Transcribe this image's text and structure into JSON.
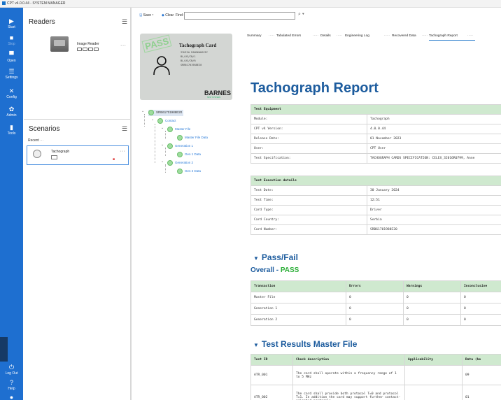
{
  "window": {
    "title": "CPT v4.0.0.44 - SYSTEM MANAGER"
  },
  "nav": {
    "items": [
      {
        "label": "Start",
        "icon": "play-icon"
      },
      {
        "label": "Stop",
        "icon": "stop-icon"
      },
      {
        "label": "Open",
        "icon": "folder-icon"
      },
      {
        "label": "Settings",
        "icon": "settings-list-icon"
      },
      {
        "label": "Config",
        "icon": "tools-icon"
      },
      {
        "label": "Admin",
        "icon": "admin-gear-icon"
      },
      {
        "label": "Tools",
        "icon": "device-icon"
      }
    ],
    "bottom": [
      {
        "label": "Log Out",
        "icon": "power-icon"
      },
      {
        "label": "Help",
        "icon": "help-icon"
      }
    ]
  },
  "readers": {
    "title": "Readers",
    "item": {
      "name": "Image Reader",
      "more": "···"
    }
  },
  "scenarios": {
    "title": "Scenarios",
    "recent_label": "Recent",
    "recent_more": "···",
    "item": {
      "name": "Tachograph",
      "more": "···"
    }
  },
  "toolbar": {
    "save": "Save",
    "clear": "Clear",
    "find_label": "Find:",
    "find_value": ""
  },
  "card": {
    "stamp": "PASS",
    "title": "Tachograph Card",
    "lines": [
      "IIKISA PANSKAKOVIC",
      "BL/US/CN/1",
      "BL/US/CN/R",
      "SRB61701988E20"
    ],
    "brand": "BARNES",
    "brand_sub": "TEST SYSTEMS"
  },
  "tree": {
    "root": "SRB61701988E20",
    "nodes": [
      {
        "label": "Contact"
      },
      {
        "label": "Master File"
      },
      {
        "label": "Master File Data"
      },
      {
        "label": "Generation 1"
      },
      {
        "label": "Gen 1 Data"
      },
      {
        "label": "Generation 2"
      },
      {
        "label": "Gen 2 Data"
      }
    ]
  },
  "tabs": [
    "Summary",
    "Tabulated Errors",
    "Details",
    "Engineering Log",
    "Recovered Data",
    "Tachograph Report"
  ],
  "tab_sep": "·····",
  "report": {
    "title": "Tachograph Report",
    "equipment": {
      "header": "Test Equipment",
      "rows": [
        [
          "Module:",
          "Tachograph"
        ],
        [
          "CPT v4 Version:",
          "4.0.0.44"
        ],
        [
          "Release Date:",
          "01 November 2023"
        ],
        [
          "User:",
          "CPT User"
        ],
        [
          "Test Specification:",
          "TACHOGRAPH CARDS SPECIFICATION: CELEX_32016R0799, Anne"
        ]
      ]
    },
    "execution": {
      "header": "Test Execution details",
      "rows": [
        [
          "Test Date:",
          "30 January 2024"
        ],
        [
          "Test Time:",
          "12:51"
        ],
        [
          "Card Type:",
          "Driver"
        ],
        [
          "Card Country:",
          "Serbia"
        ],
        [
          "Card Number:",
          "SRB61701988E20"
        ]
      ]
    },
    "passfail": {
      "heading": "Pass/Fail",
      "overall_label": "Overall - ",
      "overall_value": "PASS",
      "headers": [
        "Transaction",
        "Errors",
        "Warnings",
        "Inconclusive"
      ],
      "rows": [
        [
          "Master File",
          "0",
          "0",
          "0"
        ],
        [
          "Generation 1",
          "0",
          "0",
          "0"
        ],
        [
          "Generation 2",
          "0",
          "0",
          "0"
        ]
      ]
    },
    "results": {
      "heading": "Test Results Master File",
      "headers": [
        "Test ID",
        "Check description",
        "Applicability",
        "Data (he"
      ],
      "rows": [
        [
          "ATR_001",
          "The card shall operate within a frequency range of 1 to 5 MHz",
          "",
          "09"
        ],
        [
          "ATR_002",
          "The card shall provide both protocol T=0 and protocol T=1. In addition the card may support further contact-oriented protocols",
          "",
          "01"
        ]
      ]
    }
  },
  "colors": {
    "nav": "#1e6fd0",
    "accent": "#1d5c9e",
    "pass": "#2eaf3a",
    "table_head": "#cfe9cf"
  }
}
